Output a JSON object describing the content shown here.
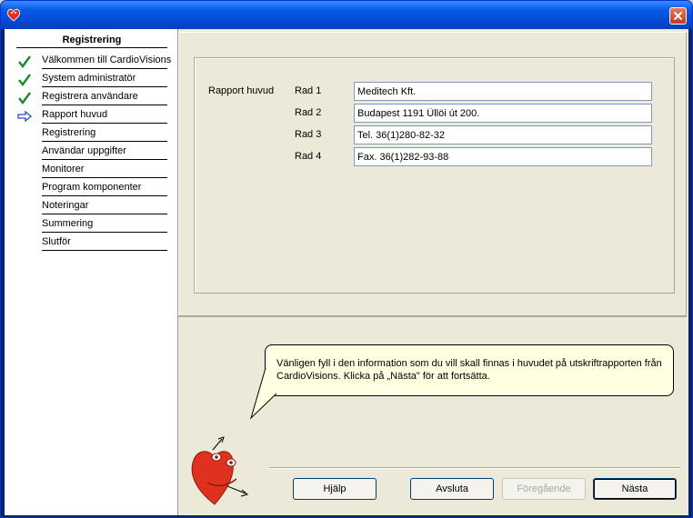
{
  "window": {
    "icon": "cardiovisions-heart-icon",
    "close_icon": "close-icon"
  },
  "sidebar": {
    "title": "Registrering",
    "items": [
      {
        "label": "Välkommen till CardioVisions",
        "status": "done"
      },
      {
        "label": "System administratör",
        "status": "done"
      },
      {
        "label": "Registrera användare",
        "status": "done"
      },
      {
        "label": "Rapport huvud",
        "status": "current"
      },
      {
        "label": "Registrering",
        "status": ""
      },
      {
        "label": "Användar uppgifter",
        "status": ""
      },
      {
        "label": "Monitorer",
        "status": ""
      },
      {
        "label": "Program komponenter",
        "status": ""
      },
      {
        "label": "Noteringar",
        "status": ""
      },
      {
        "label": "Summering",
        "status": ""
      },
      {
        "label": "Slutför",
        "status": ""
      }
    ]
  },
  "form": {
    "section_label": "Rapport huvud",
    "rows": [
      {
        "label": "Rad 1",
        "value": "Meditech Kft."
      },
      {
        "label": "Rad 2",
        "value": "Budapest 1191 Üllöi út 200."
      },
      {
        "label": "Rad 3",
        "value": "Tel. 36(1)280-82-32"
      },
      {
        "label": "Rad 4",
        "value": "Fax. 36(1)282-93-88"
      }
    ]
  },
  "help": {
    "text": "Vänligen fyll i den information som du vill skall finnas i huvudet på utskriftrapporten från CardioVisions.  Klicka på „Nästa\" för att fortsätta.",
    "mascot": "heart-mascot-icon"
  },
  "buttons": {
    "help": "Hjälp",
    "cancel": "Avsluta",
    "previous": "Föregående",
    "next": "Nästa"
  },
  "colors": {
    "check": "#1a8a2a",
    "arrow": "#2a4fbf",
    "heart": "#e0301e"
  }
}
